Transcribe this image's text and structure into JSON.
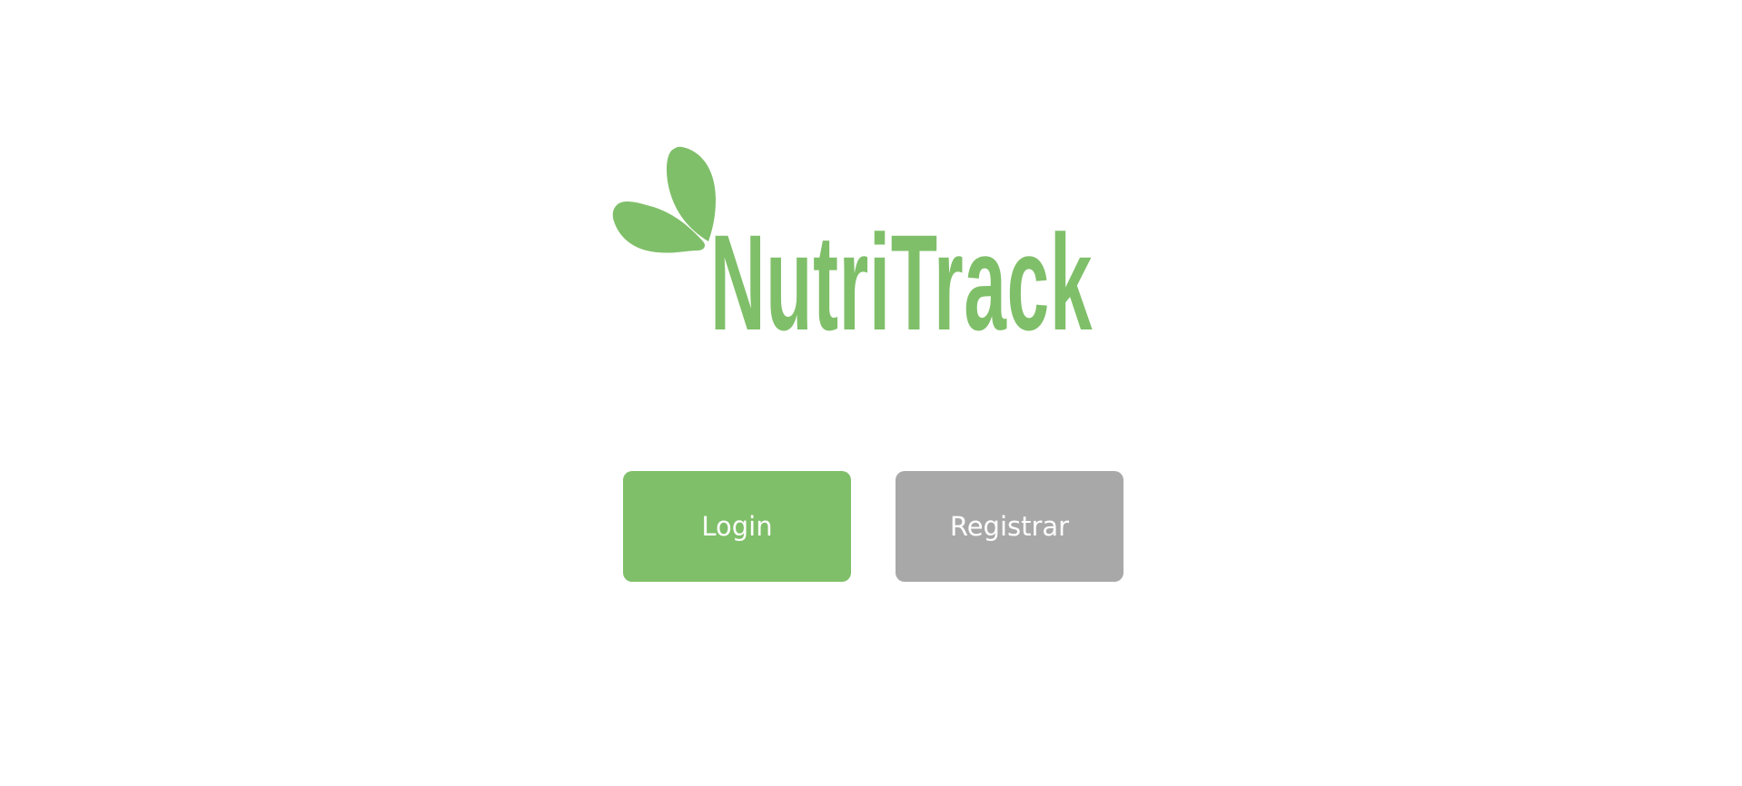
{
  "brand": {
    "name": "NutriTrack",
    "color": "#7fbf69"
  },
  "actions": {
    "login_label": "Login",
    "register_label": "Registrar",
    "login_color": "#7fbf69",
    "register_color": "#a8a8a8"
  },
  "icons": {
    "logo_mark": "leaf-icon"
  }
}
